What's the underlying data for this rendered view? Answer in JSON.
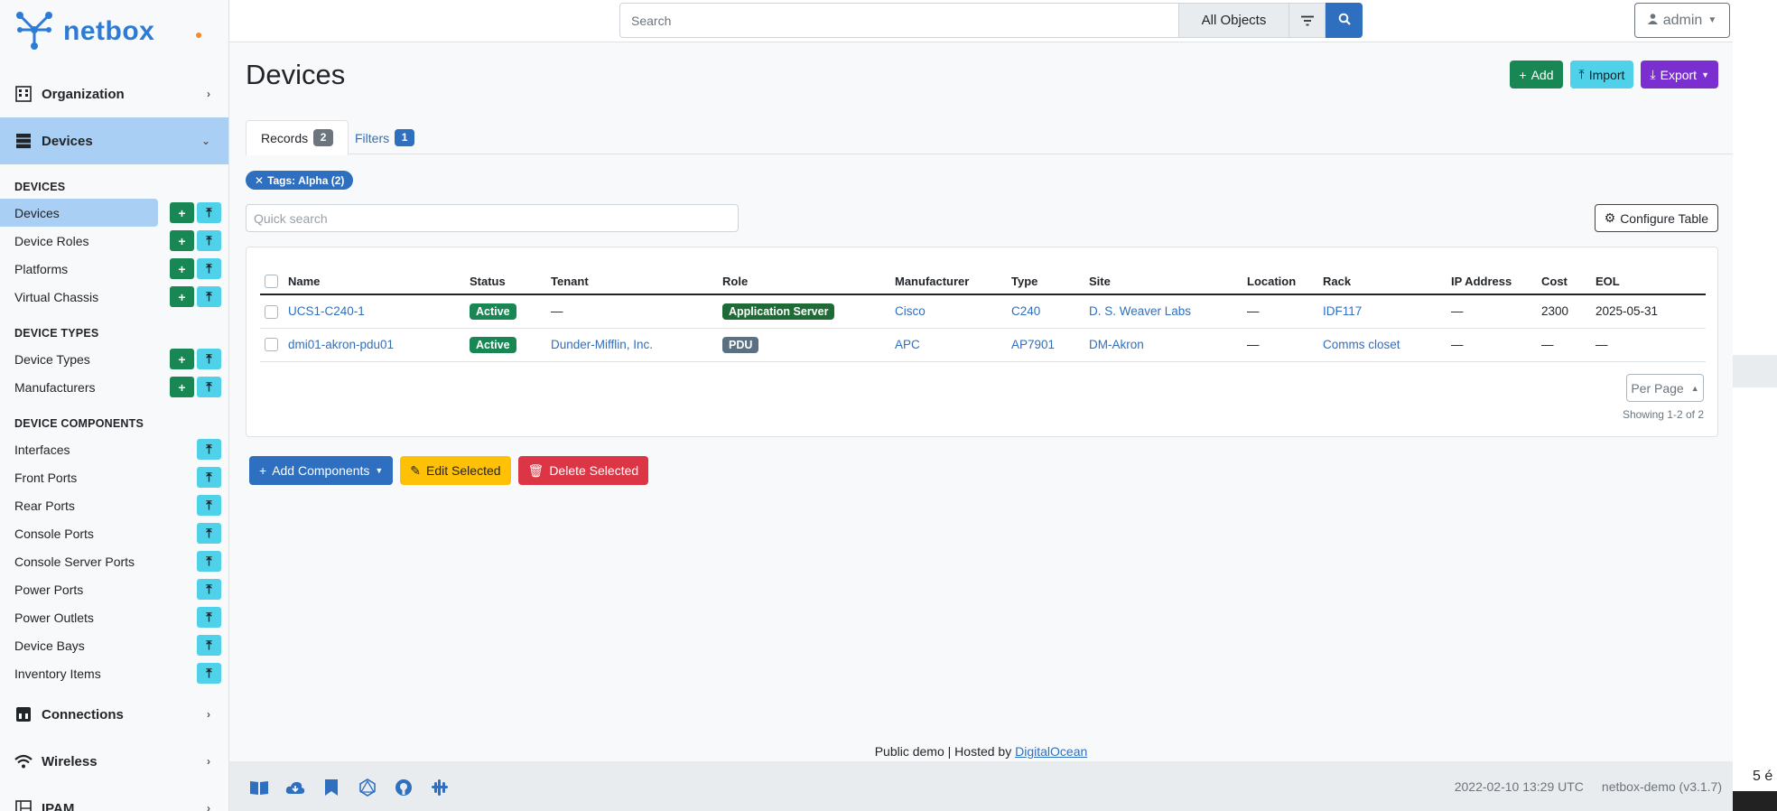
{
  "brand": {
    "name": "netbox"
  },
  "search": {
    "placeholder": "Search",
    "scope": "All Objects"
  },
  "user": {
    "name": "admin"
  },
  "sidebar": {
    "groups": {
      "organization": "Organization",
      "devices": "Devices",
      "connections": "Connections",
      "wireless": "Wireless",
      "ipam": "IPAM"
    },
    "headings": {
      "devices": "DEVICES",
      "device_types": "DEVICE TYPES",
      "device_components": "DEVICE COMPONENTS"
    },
    "devices_items": [
      "Devices",
      "Device Roles",
      "Platforms",
      "Virtual Chassis"
    ],
    "device_types_items": [
      "Device Types",
      "Manufacturers"
    ],
    "component_items": [
      "Interfaces",
      "Front Ports",
      "Rear Ports",
      "Console Ports",
      "Console Server Ports",
      "Power Ports",
      "Power Outlets",
      "Device Bays",
      "Inventory Items"
    ]
  },
  "page": {
    "title": "Devices",
    "actions": {
      "add": "Add",
      "import": "Import",
      "export": "Export"
    },
    "tabs": {
      "records": {
        "label": "Records",
        "count": "2"
      },
      "filters": {
        "label": "Filters",
        "count": "1"
      }
    },
    "filter_pill": "Tags: Alpha (2)",
    "quick_search_placeholder": "Quick search",
    "configure_table": "Configure Table"
  },
  "table": {
    "columns": [
      "Name",
      "Status",
      "Tenant",
      "Role",
      "Manufacturer",
      "Type",
      "Site",
      "Location",
      "Rack",
      "IP Address",
      "Cost",
      "EOL"
    ],
    "rows": [
      {
        "name": "UCS1-C240-1",
        "status": "Active",
        "tenant": "—",
        "role": "Application Server",
        "manufacturer": "Cisco",
        "type": "C240",
        "site": "D. S. Weaver Labs",
        "location": "—",
        "rack": "IDF117",
        "ip": "—",
        "cost": "2300",
        "eol": "2025-05-31"
      },
      {
        "name": "dmi01-akron-pdu01",
        "status": "Active",
        "tenant": "Dunder-Mifflin, Inc.",
        "role": "PDU",
        "manufacturer": "APC",
        "type": "AP7901",
        "site": "DM-Akron",
        "location": "—",
        "rack": "Comms closet",
        "ip": "—",
        "cost": "—",
        "eol": "—"
      }
    ],
    "per_page": "Per Page",
    "showing": "Showing 1-2 of 2"
  },
  "bulk": {
    "add_components": "Add Components",
    "edit_selected": "Edit Selected",
    "delete_selected": "Delete Selected"
  },
  "footer": {
    "public_demo": "Public demo | Hosted by ",
    "host_link": "DigitalOcean",
    "timestamp": "2022-02-10 13:29 UTC",
    "version": "netbox-demo (v3.1.7)"
  },
  "fringe_text": "5 é",
  "colors": {
    "primary": "#2f6fbf",
    "success": "#198754",
    "info": "#4fd1ea",
    "export": "#7b2fd0",
    "warning": "#ffc107",
    "danger": "#dc3545",
    "role_app_server": "#1e6b35",
    "role_pdu": "#5b7082"
  },
  "icons": [
    "netbox-logo-icon",
    "pin-icon",
    "building-icon",
    "server-icon",
    "connections-icon",
    "wifi-icon",
    "ipam-icon",
    "filter-icon",
    "search-icon",
    "user-icon",
    "plus-icon",
    "upload-icon",
    "gear-icon",
    "pencil-icon",
    "trash-icon",
    "book-icon",
    "cloud-icon",
    "bookmark-icon",
    "graphql-icon",
    "github-icon",
    "slack-icon"
  ]
}
